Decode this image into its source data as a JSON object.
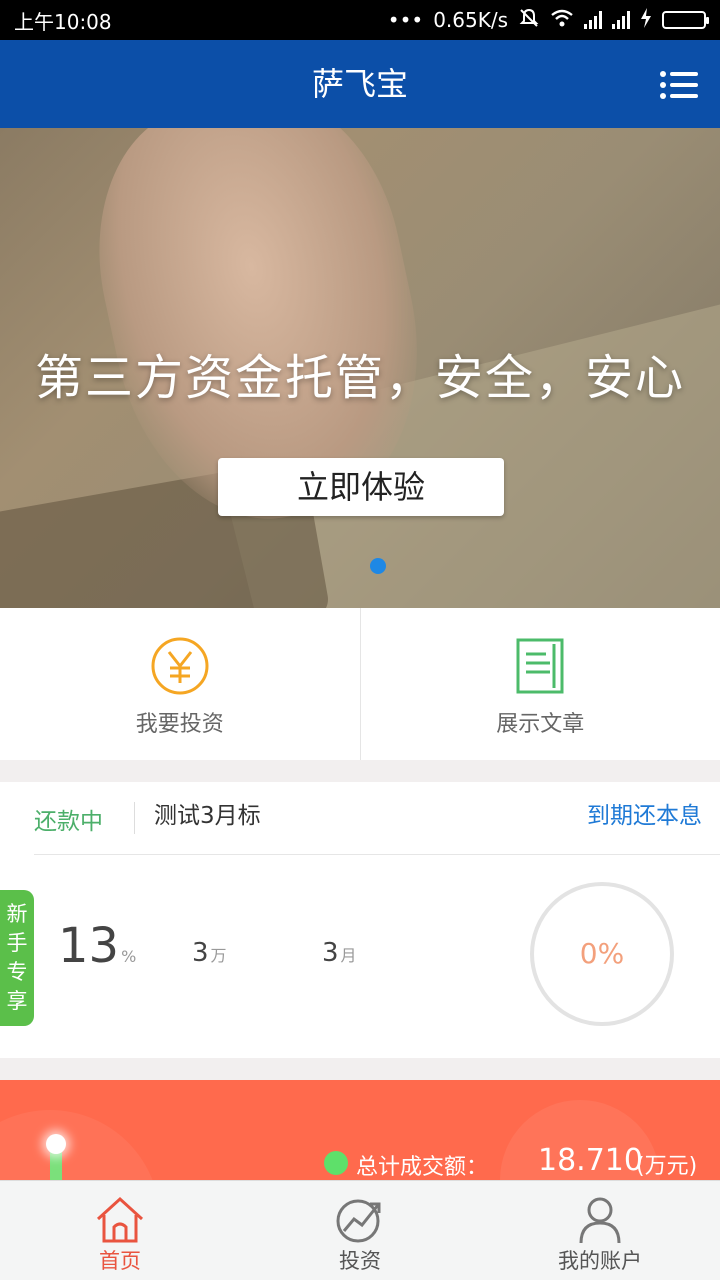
{
  "status_bar": {
    "time": "上午10:08",
    "network_speed": "0.65K/s"
  },
  "header": {
    "title": "萨飞宝",
    "menu_icon": "menu-list-icon"
  },
  "banner": {
    "slogan": "第三方资金托管，安全，安心",
    "cta_label": "立即体验",
    "active_dot_color": "#1e88e5"
  },
  "quick_actions": [
    {
      "label": "我要投资",
      "icon": "yen-coin-icon",
      "color": "#f5a623"
    },
    {
      "label": "展示文章",
      "icon": "document-icon",
      "color": "#4cbb6a"
    }
  ],
  "product": {
    "status": "还款中",
    "name": "测试3月标",
    "repayment": "到期还本息",
    "rate_value": "13",
    "rate_unit": "%",
    "amount_value": "3",
    "amount_unit": "万",
    "period_value": "3",
    "period_unit": "月",
    "progress": "0%",
    "newbie_tag": "新手专享"
  },
  "stats": {
    "label": "总计成交额：",
    "value": "18.710",
    "unit": "(万元)"
  },
  "tabs": [
    {
      "label": "首页",
      "icon": "home-icon",
      "active": true
    },
    {
      "label": "投资",
      "icon": "invest-chart-icon",
      "active": false
    },
    {
      "label": "我的账户",
      "icon": "user-icon",
      "active": false
    }
  ],
  "colors": {
    "header_bg": "#0c4fa8",
    "stats_bg": "#ff6a4d",
    "status_green": "#4caf6a",
    "link_blue": "#1f7ad6",
    "active_tab": "#e9543f"
  }
}
